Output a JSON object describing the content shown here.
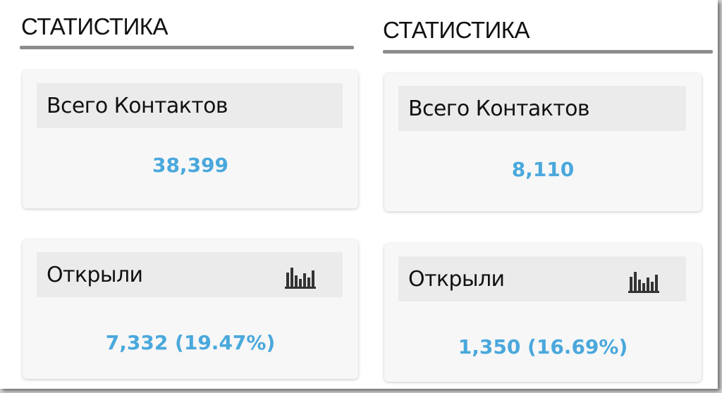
{
  "panels": [
    {
      "title": "СТАТИСТИКА",
      "total_label": "Всего Контактов",
      "total_value": "38,399",
      "opened_label": "Открыли",
      "opened_value": "7,332 (19.47%)",
      "chart_icon": "bar-chart-icon"
    },
    {
      "title": "СТАТИСТИКА",
      "total_label": "Всего Контактов",
      "total_value": "8,110",
      "opened_label": "Открыли",
      "opened_value": "1,350 (16.69%)",
      "chart_icon": "bar-chart-icon"
    }
  ],
  "colors": {
    "value": "#4aa8dc",
    "rule": "#8c8c8c",
    "card_bg": "#f7f7f7",
    "card_header_bg": "#ebebeb"
  }
}
